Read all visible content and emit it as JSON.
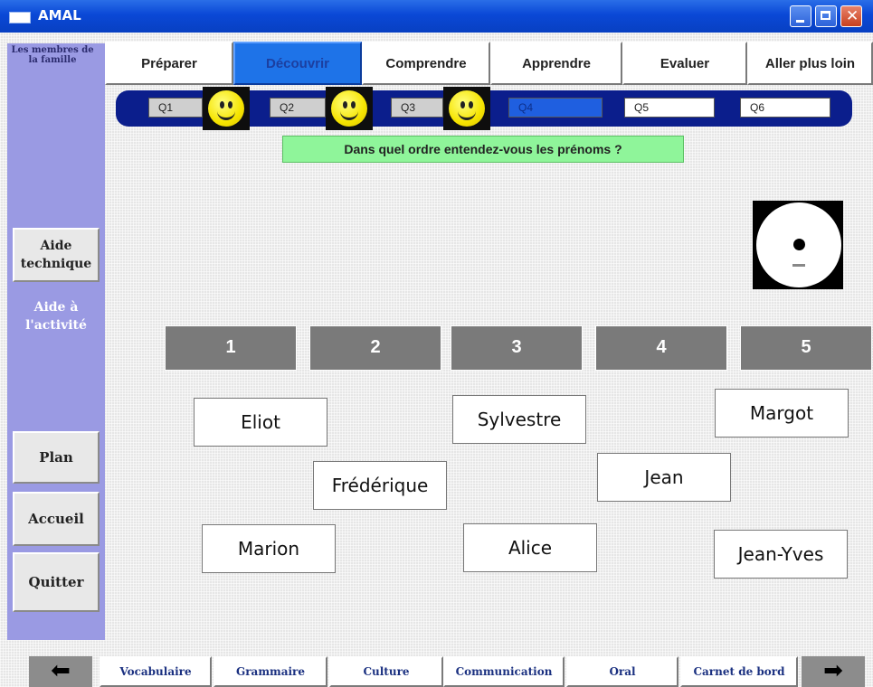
{
  "window": {
    "title": "AMAL"
  },
  "sidebar": {
    "section_title": "Les membres de la famille",
    "aide_technique": "Aide technique",
    "aide_activite": "Aide à l'activité",
    "plan": "Plan",
    "accueil": "Accueil",
    "quitter": "Quitter"
  },
  "nav_tabs": [
    {
      "label": "Préparer",
      "active": false
    },
    {
      "label": "Découvrir",
      "active": true
    },
    {
      "label": "Comprendre",
      "active": false
    },
    {
      "label": "Apprendre",
      "active": false
    },
    {
      "label": "Evaluer",
      "active": false
    },
    {
      "label": "Aller plus loin",
      "active": false
    }
  ],
  "questions": [
    {
      "label": "Q1",
      "status": "done",
      "icon": "smiley-icon"
    },
    {
      "label": "Q2",
      "status": "done",
      "icon": "smiley-icon"
    },
    {
      "label": "Q3",
      "status": "done",
      "icon": "smiley-icon"
    },
    {
      "label": "Q4",
      "status": "current"
    },
    {
      "label": "Q5",
      "status": "todo"
    },
    {
      "label": "Q6",
      "status": "todo"
    }
  ],
  "instruction": "Dans quel ordre entendez-vous les prénoms ?",
  "audio": {
    "icon": "cd-play-icon"
  },
  "slots": [
    "1",
    "2",
    "3",
    "4",
    "5"
  ],
  "names": [
    "Eliot",
    "Sylvestre",
    "Margot",
    "Frédérique",
    "Jean",
    "Marion",
    "Alice",
    "Jean-Yves"
  ],
  "bottom_tabs": [
    "Vocabulaire",
    "Grammaire",
    "Culture",
    "Communication",
    "Oral",
    "Carnet de bord"
  ],
  "colors": {
    "titlebar": "#0a48d6",
    "sidebar": "#9a9ae3",
    "active_tab": "#1e73e8",
    "question_bar": "#0b1e8c",
    "instruction_bg": "#8ff59a",
    "slot": "#7a7a7a"
  }
}
